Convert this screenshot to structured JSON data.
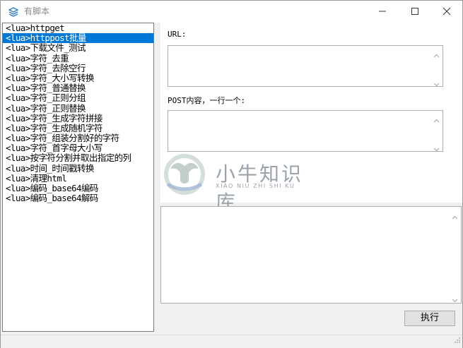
{
  "window": {
    "title": "有脚本"
  },
  "list": {
    "items": [
      "<lua>httpget",
      "<lua>httppost批量",
      "<lua>下载文件_测试",
      "<lua>字符_去重",
      "<lua>字符_去除空行",
      "<lua>字符_大小写转换",
      "<lua>字符_普通替换",
      "<lua>字符_正则分组",
      "<lua>字符_正则替换",
      "<lua>字符_生成字符拼接",
      "<lua>字符_生成随机字符",
      "<lua>字符_组装分割好的字符",
      "<lua>字符_首字母大小写",
      "<lua>按字符分割并取出指定的列",
      "<lua>时间_时间戳转换",
      "<lua>清理html",
      "<lua>编码_base64编码",
      "<lua>编码_base64解码"
    ],
    "selected_index": 1
  },
  "form": {
    "url_label": "URL:",
    "post_label": "POST内容，一行一个:",
    "url_value": "",
    "post_value": "",
    "output_value": ""
  },
  "actions": {
    "run_label": "执行"
  },
  "watermark": {
    "title": "小牛知识库",
    "subtitle": "XIAO NIU ZHI SHI KU"
  },
  "colors": {
    "selection": "#0078d7",
    "accent": "#0078d7",
    "watermark": "#9aa3ab"
  },
  "icons": {
    "app": "layers-icon",
    "minimize": "minimize-icon",
    "maximize": "maximize-icon",
    "close": "close-icon"
  }
}
